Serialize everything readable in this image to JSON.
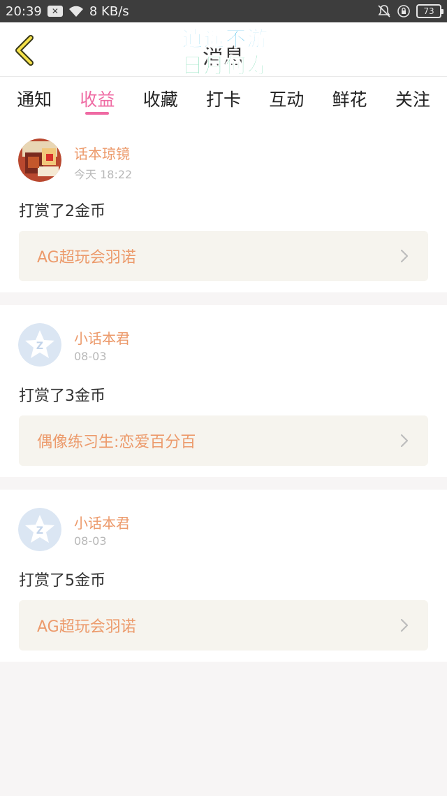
{
  "status_bar": {
    "time": "20:39",
    "speed": "8 KB/s",
    "battery": "73",
    "icons": [
      "close-box-icon",
      "wifi-icon",
      "mute-bell-icon",
      "rotation-lock-icon"
    ]
  },
  "header": {
    "title": "消息",
    "back_icon": "chevron-left-icon",
    "watermark_line1": "逍遥不游",
    "watermark_line2": "日月何寿"
  },
  "tabs": [
    {
      "label": "通知"
    },
    {
      "label": "收益"
    },
    {
      "label": "收藏"
    },
    {
      "label": "打卡"
    },
    {
      "label": "互动"
    },
    {
      "label": "鲜花"
    },
    {
      "label": "关注"
    }
  ],
  "active_tab": "收益",
  "messages": [
    {
      "user": "话本琼镜",
      "time": "今天 18:22",
      "text": "打赏了2金币",
      "book": "AG超玩会羽诺"
    },
    {
      "user": "小话本君",
      "time": "08-03",
      "text": "打赏了3金币",
      "book": "偶像练习生:恋爱百分百"
    },
    {
      "user": "小话本君",
      "time": "08-03",
      "text": "打赏了5金币",
      "book": "AG超玩会羽诺"
    }
  ],
  "colors": {
    "accent_pink": "#ef6aa3",
    "name_orange": "#ec9a6b",
    "status_bar": "#3d3d3d",
    "watermark_blue": "#2fb5e8",
    "watermark_green": "#36c98a"
  }
}
